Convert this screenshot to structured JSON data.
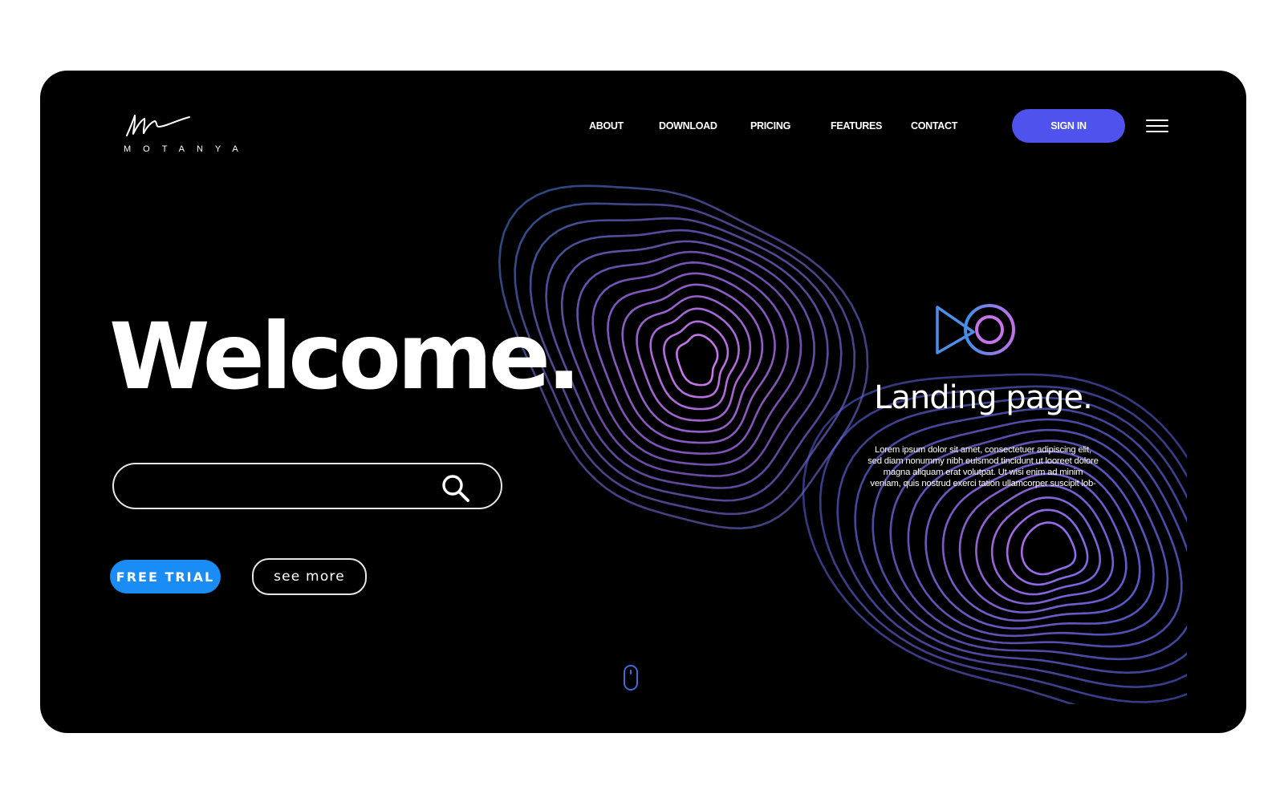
{
  "brand": {
    "name": "MOTANYA",
    "logo_icon": "signature-m-logo"
  },
  "nav": {
    "items": [
      {
        "label": "ABOUT"
      },
      {
        "label": "DOWNLOAD"
      },
      {
        "label": "PRICING"
      },
      {
        "label": "FEATURES"
      },
      {
        "label": "CONTACT"
      }
    ],
    "sign_in_label": "SIGN IN",
    "menu_icon": "hamburger-menu-icon"
  },
  "hero": {
    "title": "Welcome.",
    "search": {
      "placeholder": "",
      "value": "",
      "icon": "search-icon"
    },
    "free_trial_label": "FREE TRIAL",
    "see_more_label": "see more"
  },
  "landing": {
    "icon": "play-circle-logo",
    "title": "Landing page.",
    "lines": [
      "Lorem ipsum dolor sit amet, consectetuer adipiscing elit,",
      "sed diam nonummy nibh euismod tincidunt ut looreet dolore",
      "magna aliquam erat volutpat. Ut wisi enim ad minim",
      "veniam, quis nostrud exerci tation ullamcorper suscipit lob-"
    ]
  },
  "scroll_indicator": "mouse-scroll-icon",
  "colors": {
    "background": "#000000",
    "sign_in": "#4f52ec",
    "free_trial": "#1a8cf5",
    "contour_outer": "#5b7fe0",
    "contour_inner": "#c070e8"
  }
}
